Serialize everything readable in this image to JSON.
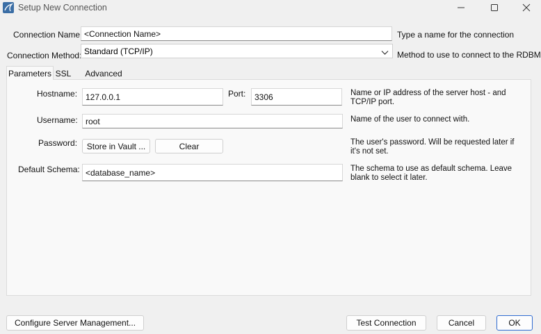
{
  "window": {
    "title": "Setup New Connection",
    "controls": [
      "minimize-icon",
      "maximize-icon",
      "close-icon"
    ]
  },
  "connection": {
    "name_label": "Connection Name:",
    "name_value": "<Connection Name>",
    "name_help": "Type a name for the connection",
    "method_label": "Connection Method:",
    "method_value": "Standard (TCP/IP)",
    "method_help": "Method to use to connect to the RDBMS"
  },
  "tabs": [
    {
      "label": "Parameters",
      "active": true
    },
    {
      "label": "SSL",
      "active": false
    },
    {
      "label": "Advanced",
      "active": false
    }
  ],
  "params": {
    "hostname_label": "Hostname:",
    "hostname_value": "127.0.0.1",
    "port_label": "Port:",
    "port_value": "3306",
    "hostname_help": "Name or IP address of the server host - and TCP/IP port.",
    "username_label": "Username:",
    "username_value": "root",
    "username_help": "Name of the user to connect with.",
    "password_label": "Password:",
    "store_vault_label": "Store in Vault ...",
    "clear_label": "Clear",
    "password_help": "The user's password. Will be requested later if it's not set.",
    "schema_label": "Default Schema:",
    "schema_value": "<database_name>",
    "schema_help": "The schema to use as default schema. Leave blank to select it later."
  },
  "footer": {
    "configure_label": "Configure Server Management...",
    "test_label": "Test Connection",
    "cancel_label": "Cancel",
    "ok_label": "OK"
  }
}
